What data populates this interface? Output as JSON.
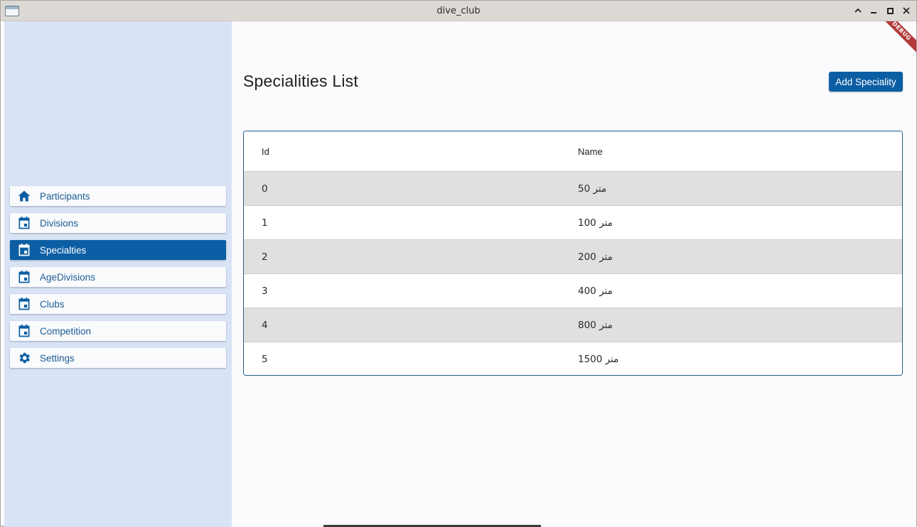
{
  "window": {
    "title": "dive_club"
  },
  "sidebar": {
    "items": [
      {
        "label": "Participants",
        "icon": "home-icon"
      },
      {
        "label": "Divisions",
        "icon": "calendar-icon"
      },
      {
        "label": "Specialties",
        "icon": "calendar-icon",
        "active": true
      },
      {
        "label": "AgeDivisions",
        "icon": "calendar-icon"
      },
      {
        "label": "Clubs",
        "icon": "calendar-icon"
      },
      {
        "label": "Competition",
        "icon": "calendar-icon"
      },
      {
        "label": "Settings",
        "icon": "gear-icon"
      }
    ]
  },
  "main": {
    "title": "Specialities List",
    "add_button": "Add Speciality",
    "debug_banner": "DEBUG",
    "table": {
      "columns": [
        "Id",
        "Name"
      ],
      "rows": [
        {
          "id": "0",
          "name": "50 متر"
        },
        {
          "id": "1",
          "name": "100 متر"
        },
        {
          "id": "2",
          "name": "200 متر"
        },
        {
          "id": "3",
          "name": "400 متر"
        },
        {
          "id": "4",
          "name": "800 متر"
        },
        {
          "id": "5",
          "name": "1500 متر"
        }
      ]
    }
  },
  "colors": {
    "accent": "#0b5ea3",
    "sidebar_bg": "#d8e3f6",
    "row_alt": "#e0e0e0",
    "debug_ribbon": "#b23b3a"
  }
}
